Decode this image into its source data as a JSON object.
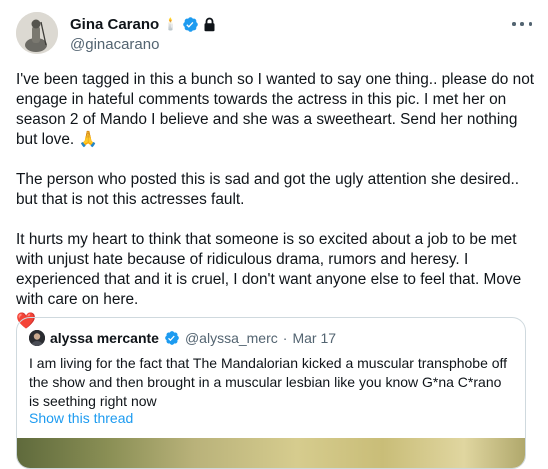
{
  "author": {
    "display_name": "Gina Carano",
    "handle": "@ginacarano",
    "candle": "🕯️"
  },
  "tweet": {
    "paragraphs": [
      "I've been tagged in this a bunch so I wanted to say one thing.. please do not engage in hateful comments towards the actress in this pic. I met her on season 2 of Mando I believe and she was a sweetheart. Send her nothing but love. 🙏",
      "The person who posted this is sad and got the ugly attention she desired.. but that is not this actresses fault.",
      "It hurts my heart to think that someone is so excited about a job to be met with unjust hate because of ridiculous drama, rumors and heresy. I experienced that and it is cruel, I don't want anyone else to feel that. Move with care on here."
    ],
    "heart": "❤️"
  },
  "quoted": {
    "display_name": "alyssa mercante",
    "handle": "@alyssa_merc",
    "separator": "·",
    "date": "Mar 17",
    "text": "I am living for the fact that The Mandalorian kicked a muscular transphobe off the show and then brought in a muscular lesbian like you know G*na C*rano is seething right now",
    "thread_link": "Show this thread"
  },
  "colors": {
    "verified": "#1d9bf0",
    "link": "#1d9bf0",
    "secondary_text": "#536471",
    "border": "#cfd9de"
  },
  "icons": [
    "candle-icon",
    "verified-icon",
    "lock-icon",
    "more-icon",
    "heart-icon"
  ]
}
